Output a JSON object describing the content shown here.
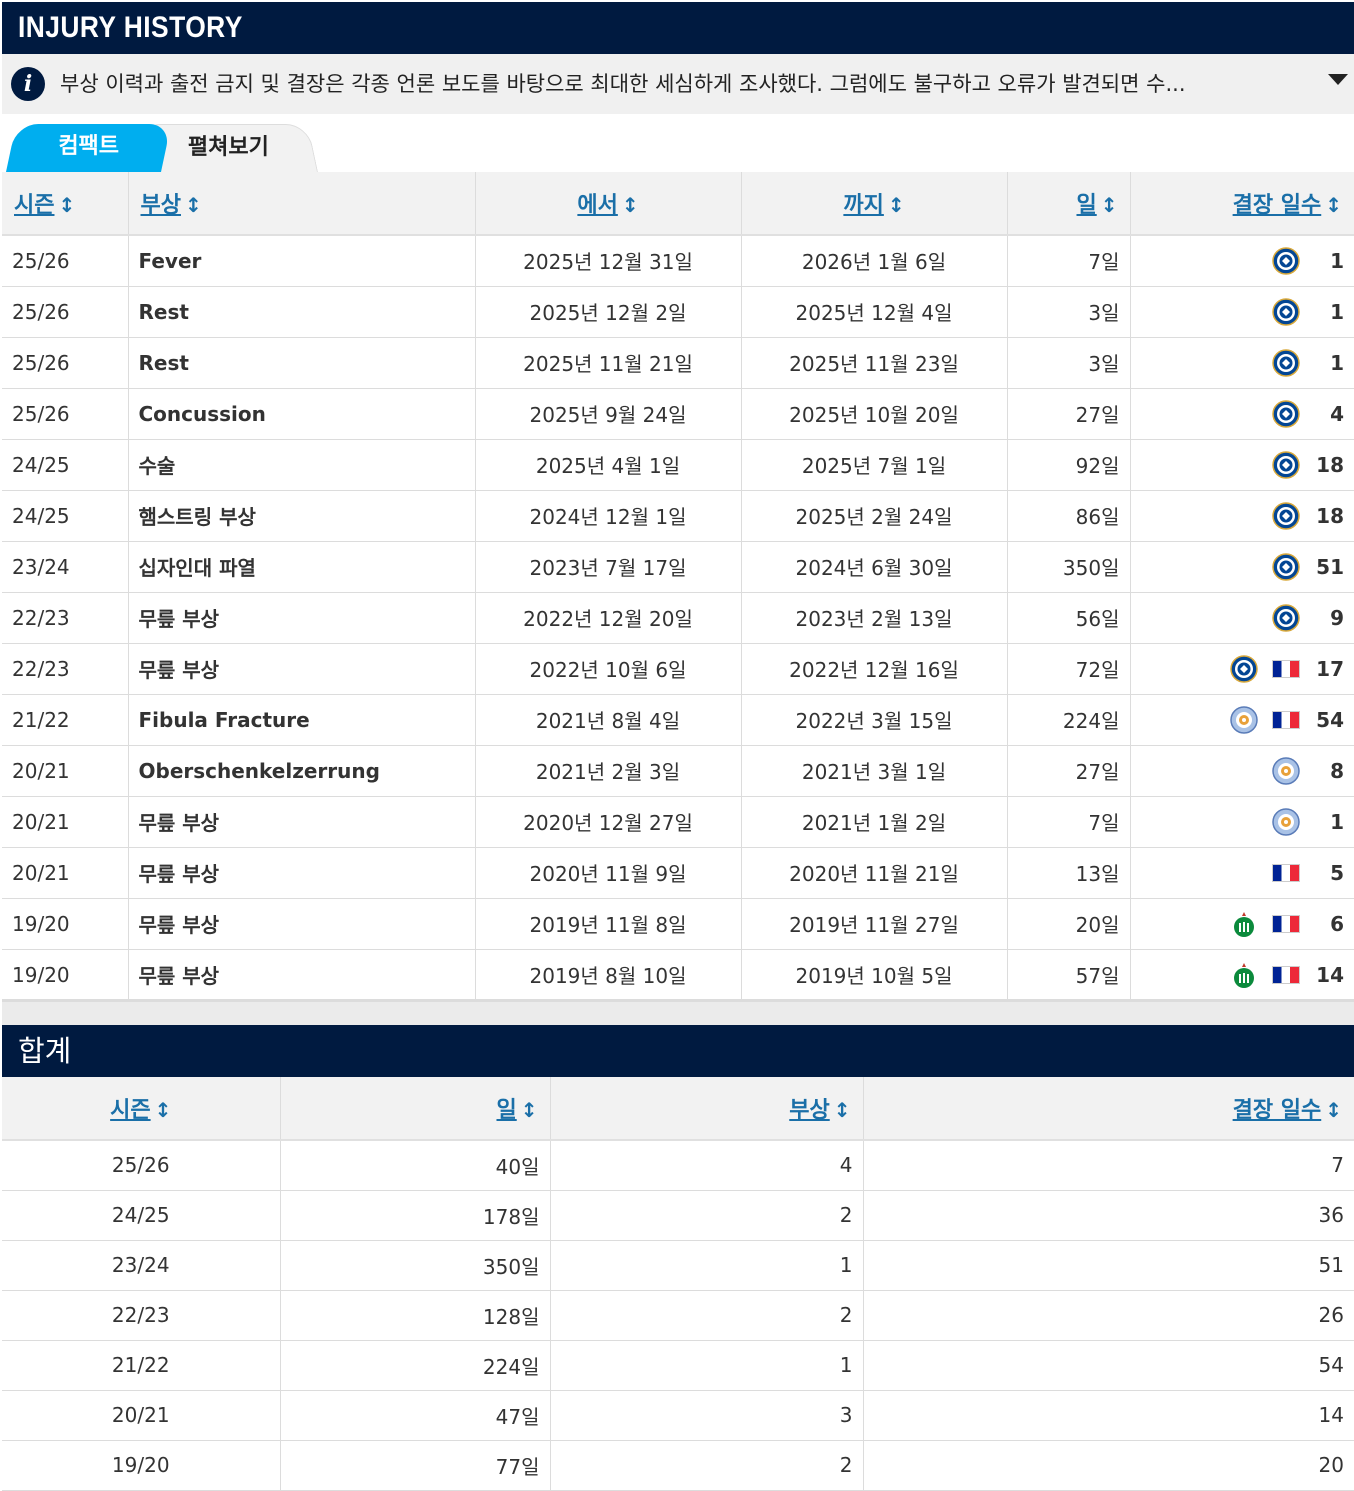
{
  "header": {
    "title": "INJURY HISTORY"
  },
  "info": {
    "text": "부상 이력과 출전 금지 및 결장은 각종 언론 보도를 바탕으로 최대한 세심하게 조사했다. 그럼에도 불구하고 오류가 발견되면 수..."
  },
  "tabs": [
    {
      "label": "컴팩트"
    },
    {
      "label": "펼쳐보기"
    }
  ],
  "injury_table": {
    "columns": [
      "시즌",
      "부상",
      "에서",
      "까지",
      "일",
      "결장 일수"
    ],
    "rows": [
      {
        "season": "25/26",
        "injury": "Fever",
        "from": "2025년 12월 31일",
        "until": "2026년 1월 6일",
        "days": "7일",
        "clubs": [
          "chelsea-crest-icon"
        ],
        "games": "1"
      },
      {
        "season": "25/26",
        "injury": "Rest",
        "from": "2025년 12월 2일",
        "until": "2025년 12월 4일",
        "days": "3일",
        "clubs": [
          "chelsea-crest-icon"
        ],
        "games": "1"
      },
      {
        "season": "25/26",
        "injury": "Rest",
        "from": "2025년 11월 21일",
        "until": "2025년 11월 23일",
        "days": "3일",
        "clubs": [
          "chelsea-crest-icon"
        ],
        "games": "1"
      },
      {
        "season": "25/26",
        "injury": "Concussion",
        "from": "2025년 9월 24일",
        "until": "2025년 10월 20일",
        "days": "27일",
        "clubs": [
          "chelsea-crest-icon"
        ],
        "games": "4"
      },
      {
        "season": "24/25",
        "injury": "수술",
        "from": "2025년 4월 1일",
        "until": "2025년 7월 1일",
        "days": "92일",
        "clubs": [
          "chelsea-crest-icon"
        ],
        "games": "18"
      },
      {
        "season": "24/25",
        "injury": "햄스트링 부상",
        "from": "2024년 12월 1일",
        "until": "2025년 2월 24일",
        "days": "86일",
        "clubs": [
          "chelsea-crest-icon"
        ],
        "games": "18"
      },
      {
        "season": "23/24",
        "injury": "십자인대 파열",
        "from": "2023년 7월 17일",
        "until": "2024년 6월 30일",
        "days": "350일",
        "clubs": [
          "chelsea-crest-icon"
        ],
        "games": "51"
      },
      {
        "season": "22/23",
        "injury": "무릎 부상",
        "from": "2022년 12월 20일",
        "until": "2023년 2월 13일",
        "days": "56일",
        "clubs": [
          "chelsea-crest-icon"
        ],
        "games": "9"
      },
      {
        "season": "22/23",
        "injury": "무릎 부상",
        "from": "2022년 10월 6일",
        "until": "2022년 12월 16일",
        "days": "72일",
        "clubs": [
          "chelsea-crest-icon",
          "france-flag-icon"
        ],
        "games": "17"
      },
      {
        "season": "21/22",
        "injury": "Fibula Fracture",
        "from": "2021년 8월 4일",
        "until": "2022년 3월 15일",
        "days": "224일",
        "clubs": [
          "leicester-crest-icon",
          "france-flag-icon"
        ],
        "games": "54"
      },
      {
        "season": "20/21",
        "injury": "Oberschenkelzerrung",
        "from": "2021년 2월 3일",
        "until": "2021년 3월 1일",
        "days": "27일",
        "clubs": [
          "leicester-crest-icon"
        ],
        "games": "8"
      },
      {
        "season": "20/21",
        "injury": "무릎 부상",
        "from": "2020년 12월 27일",
        "until": "2021년 1월 2일",
        "days": "7일",
        "clubs": [
          "leicester-crest-icon"
        ],
        "games": "1"
      },
      {
        "season": "20/21",
        "injury": "무릎 부상",
        "from": "2020년 11월 9일",
        "until": "2020년 11월 21일",
        "days": "13일",
        "clubs": [
          "france-flag-icon"
        ],
        "games": "5"
      },
      {
        "season": "19/20",
        "injury": "무릎 부상",
        "from": "2019년 11월 8일",
        "until": "2019년 11월 27일",
        "days": "20일",
        "clubs": [
          "saint-etienne-crest-icon",
          "france-flag-icon"
        ],
        "games": "6"
      },
      {
        "season": "19/20",
        "injury": "무릎 부상",
        "from": "2019년 8월 10일",
        "until": "2019년 10월 5일",
        "days": "57일",
        "clubs": [
          "saint-etienne-crest-icon",
          "france-flag-icon"
        ],
        "games": "14"
      }
    ]
  },
  "summary": {
    "title": "합계",
    "columns": [
      "시즌",
      "일",
      "부상",
      "결장 일수"
    ],
    "rows": [
      {
        "season": "25/26",
        "days": "40일",
        "injuries": "4",
        "games": "7"
      },
      {
        "season": "24/25",
        "days": "178일",
        "injuries": "2",
        "games": "36"
      },
      {
        "season": "23/24",
        "days": "350일",
        "injuries": "1",
        "games": "51"
      },
      {
        "season": "22/23",
        "days": "128일",
        "injuries": "2",
        "games": "26"
      },
      {
        "season": "21/22",
        "days": "224일",
        "injuries": "1",
        "games": "54"
      },
      {
        "season": "20/21",
        "days": "47일",
        "injuries": "3",
        "games": "14"
      },
      {
        "season": "19/20",
        "days": "77일",
        "injuries": "2",
        "games": "20"
      }
    ]
  },
  "colors": {
    "navy": "#001a40",
    "accent": "#00aeef",
    "link": "#1a6fa8"
  }
}
